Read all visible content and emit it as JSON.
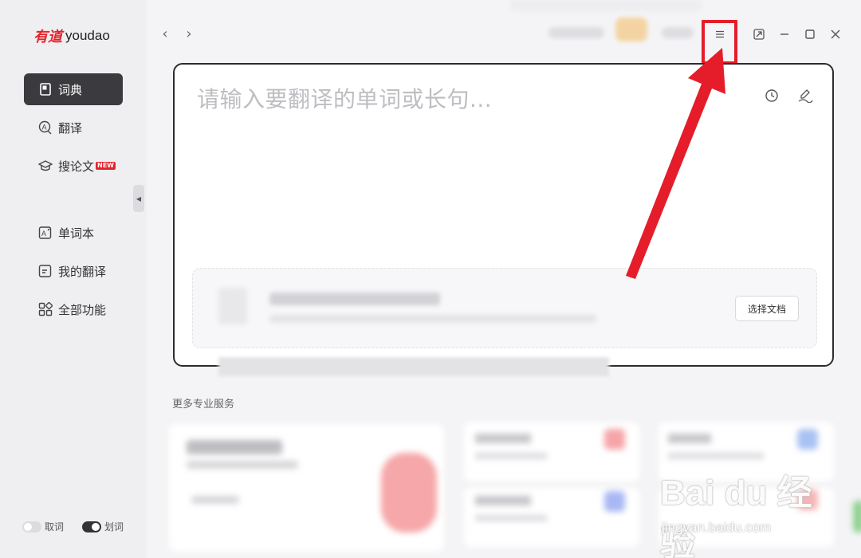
{
  "app": {
    "logo_cn": "有道",
    "logo_en": "youdao"
  },
  "sidebar": {
    "items": [
      {
        "label": "词典",
        "icon": "book-icon",
        "active": true
      },
      {
        "label": "翻译",
        "icon": "translate-icon",
        "active": false
      },
      {
        "label": "搜论文",
        "icon": "graduation-cap-icon",
        "active": false,
        "badge": "NEW"
      },
      {
        "label": "单词本",
        "icon": "wordbook-icon",
        "active": false
      },
      {
        "label": "我的翻译",
        "icon": "my-translation-icon",
        "active": false
      },
      {
        "label": "全部功能",
        "icon": "grid-icon",
        "active": false
      }
    ],
    "toggles": [
      {
        "label": "取词",
        "on": false
      },
      {
        "label": "划词",
        "on": true
      }
    ]
  },
  "main": {
    "input_placeholder": "请输入要翻译的单词或长句...",
    "upload_button": "选择文档",
    "more_services_title": "更多专业服务"
  },
  "watermark": {
    "main": "Bai du 经验",
    "sub": "jingyan.baidu.com"
  },
  "colors": {
    "accent_red": "#e51d2a",
    "active_nav": "#3b3b3f",
    "logo_red": "#e3242b"
  }
}
